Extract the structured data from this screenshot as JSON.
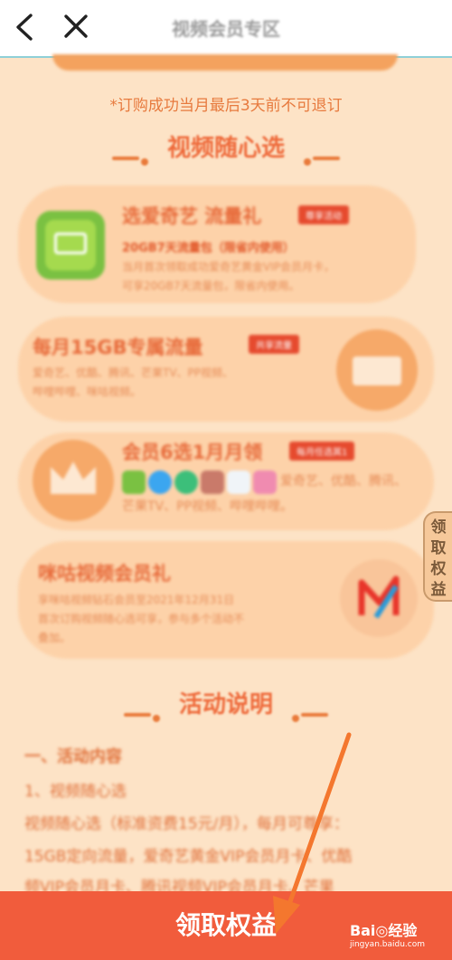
{
  "header": {
    "title": "视频会员专区"
  },
  "notice": "*订购成功当月最后3天前不可退订",
  "sections": {
    "video": "视频随心选",
    "activity": "活动说明"
  },
  "cards": [
    {
      "title": "选爱奇艺 流量礼",
      "tag": "尊享活动",
      "sub": "20GB7天流量包（限省内使用）",
      "desc1": "当月首次领取成功爱奇艺黄金VIP会员月卡，",
      "desc2": "可享20GB7天流量包，限省内使用。"
    },
    {
      "title": "每月15GB专属流量",
      "tag": "共享流量",
      "desc1": "爱奇艺、优酷、腾讯、芒果TV、PP视频、",
      "desc2": "哔哩哔哩、咪咕视频。"
    },
    {
      "title": "会员6选1月月领",
      "tag": "每月任选其1",
      "desc1": "爱奇艺、优酷、腾讯、",
      "desc2": "芒果TV、PP视频、哔哩哔哩。"
    },
    {
      "title": "咪咕视频会员礼",
      "desc1": "享咪咕视频钻石会员至2021年12月31日",
      "desc2": "首次订购视频随心选可享，参与多个活动不",
      "desc3": "叠加。"
    }
  ],
  "side_tab": [
    "领",
    "取",
    "权",
    "益"
  ],
  "activity": {
    "heading": "一、活动内容",
    "item1": "1、视频随心选",
    "line1": "视频随心选（标准资费15元/月），每月可尊享：",
    "line2": "15GB定向流量，爱奇艺黄金VIP会员月卡、优酷",
    "line3": "频VIP会员月卡、腾讯视频VIP会员月卡、芒果"
  },
  "bottom_button": "领取权益",
  "watermark": {
    "brand": "Bai◎经验",
    "url": "jingyan.baidu.com"
  },
  "colors": {
    "primary": "#f15c3c",
    "background": "#fde3c6",
    "accent": "#ee6a3b"
  }
}
